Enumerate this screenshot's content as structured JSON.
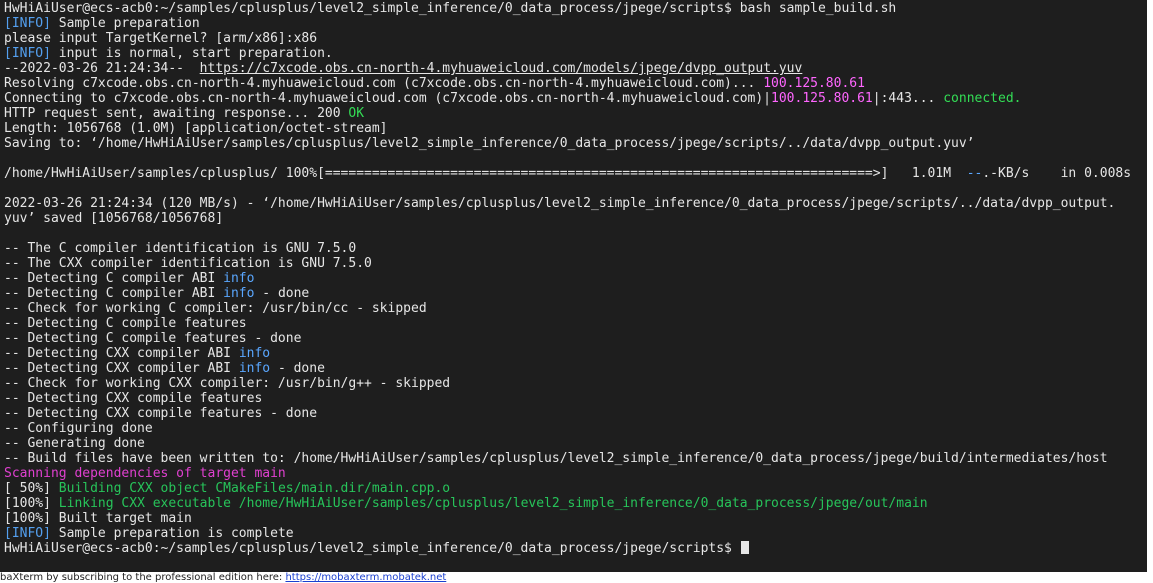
{
  "colors": {
    "background": "#1e1e1e",
    "text": "#e6e6e6",
    "info_tag": "#54a0f0",
    "ip_address": "#ff66ff",
    "ok": "#33dd55",
    "magenta": "#e040d0",
    "green": "#27c45a",
    "blue": "#5aa7ff"
  },
  "terminal": {
    "lines": [
      [
        {
          "t": "HwHiAiUser@ecs-acb0:~/samples/cplusplus/level2_simple_inference/0_data_process/jpege/scripts$ bash sample_build.sh",
          "c": "default"
        }
      ],
      [
        {
          "t": "[INFO]",
          "c": "info-tag"
        },
        {
          "t": " Sample preparation",
          "c": "default"
        }
      ],
      [
        {
          "t": "please input TargetKernel? [arm/x86]:x86",
          "c": "default"
        }
      ],
      [
        {
          "t": "[INFO]",
          "c": "info-tag"
        },
        {
          "t": " input is normal, start preparation.",
          "c": "default"
        }
      ],
      [
        {
          "t": "--2022-03-26 21:24:34--  ",
          "c": "default"
        },
        {
          "t": "https://c7xcode.obs.cn-north-4.myhuaweicloud.com/models/jpege/dvpp_output.yuv",
          "c": "url"
        }
      ],
      [
        {
          "t": "Resolving c7xcode.obs.cn-north-4.myhuaweicloud.com (c7xcode.obs.cn-north-4.myhuaweicloud.com)... ",
          "c": "default"
        },
        {
          "t": "100.125.80.61",
          "c": "ip"
        }
      ],
      [
        {
          "t": "Connecting to c7xcode.obs.cn-north-4.myhuaweicloud.com (c7xcode.obs.cn-north-4.myhuaweicloud.com)|",
          "c": "default"
        },
        {
          "t": "100.125.80.61",
          "c": "ip"
        },
        {
          "t": "|:443... ",
          "c": "default"
        },
        {
          "t": "connected.",
          "c": "ok"
        }
      ],
      [
        {
          "t": "HTTP request sent, awaiting response... 200 ",
          "c": "default"
        },
        {
          "t": "OK",
          "c": "ok"
        }
      ],
      [
        {
          "t": "Length: 1056768 (1.0M) [application/octet-stream]",
          "c": "default"
        }
      ],
      [
        {
          "t": "Saving to: ‘/home/HwHiAiUser/samples/cplusplus/level2_simple_inference/0_data_process/jpege/scripts/../data/dvpp_output.yuv’",
          "c": "default"
        }
      ],
      [
        {
          "t": "",
          "c": "default"
        }
      ],
      [
        {
          "t": "/home/HwHiAiUser/samples/cplusplus/ 100%[======================================================================>]   1.01M  ",
          "c": "default"
        },
        {
          "t": "--",
          "c": "blue"
        },
        {
          "t": ".-KB/s    in 0.008s",
          "c": "default"
        }
      ],
      [
        {
          "t": "",
          "c": "default"
        }
      ],
      [
        {
          "t": "2022-03-26 21:24:34 (120 MB/s) - ‘/home/HwHiAiUser/samples/cplusplus/level2_simple_inference/0_data_process/jpege/scripts/../data/dvpp_output.",
          "c": "default"
        }
      ],
      [
        {
          "t": "yuv’ saved [1056768/1056768]",
          "c": "default"
        }
      ],
      [
        {
          "t": "",
          "c": "default"
        }
      ],
      [
        {
          "t": "-- The C compiler identification is GNU 7.5.0",
          "c": "default"
        }
      ],
      [
        {
          "t": "-- The CXX compiler identification is GNU 7.5.0",
          "c": "default"
        }
      ],
      [
        {
          "t": "-- Detecting C compiler ABI ",
          "c": "default"
        },
        {
          "t": "info",
          "c": "blue"
        }
      ],
      [
        {
          "t": "-- Detecting C compiler ABI ",
          "c": "default"
        },
        {
          "t": "info",
          "c": "blue"
        },
        {
          "t": " - done",
          "c": "default"
        }
      ],
      [
        {
          "t": "-- Check for working C compiler: /usr/bin/cc - skipped",
          "c": "default"
        }
      ],
      [
        {
          "t": "-- Detecting C compile features",
          "c": "default"
        }
      ],
      [
        {
          "t": "-- Detecting C compile features - done",
          "c": "default"
        }
      ],
      [
        {
          "t": "-- Detecting CXX compiler ABI ",
          "c": "default"
        },
        {
          "t": "info",
          "c": "blue"
        }
      ],
      [
        {
          "t": "-- Detecting CXX compiler ABI ",
          "c": "default"
        },
        {
          "t": "info",
          "c": "blue"
        },
        {
          "t": " - done",
          "c": "default"
        }
      ],
      [
        {
          "t": "-- Check for working CXX compiler: /usr/bin/g++ - skipped",
          "c": "default"
        }
      ],
      [
        {
          "t": "-- Detecting CXX compile features",
          "c": "default"
        }
      ],
      [
        {
          "t": "-- Detecting CXX compile features - done",
          "c": "default"
        }
      ],
      [
        {
          "t": "-- Configuring done",
          "c": "default"
        }
      ],
      [
        {
          "t": "-- Generating done",
          "c": "default"
        }
      ],
      [
        {
          "t": "-- Build files have been written to: /home/HwHiAiUser/samples/cplusplus/level2_simple_inference/0_data_process/jpege/build/intermediates/host",
          "c": "default"
        }
      ],
      [
        {
          "t": "Scanning dependencies of target main",
          "c": "magenta"
        }
      ],
      [
        {
          "t": "[ 50%] ",
          "c": "default"
        },
        {
          "t": "Building CXX object CMakeFiles/main.dir/main.cpp.o",
          "c": "green"
        }
      ],
      [
        {
          "t": "[100%] ",
          "c": "default"
        },
        {
          "t": "Linking CXX executable /home/HwHiAiUser/samples/cplusplus/level2_simple_inference/0_data_process/jpege/out/main",
          "c": "green"
        }
      ],
      [
        {
          "t": "[100%] Built target main",
          "c": "default"
        }
      ],
      [
        {
          "t": "[INFO]",
          "c": "info-tag"
        },
        {
          "t": " Sample preparation is complete",
          "c": "default"
        }
      ],
      [
        {
          "t": "HwHiAiUser@ecs-acb0:~/samples/cplusplus/level2_simple_inference/0_data_process/jpege/scripts$ ",
          "c": "default"
        }
      ]
    ]
  },
  "footer": {
    "text": "baXterm by subscribing to the professional edition here:  ",
    "link": "https://mobaxterm.mobatek.net"
  }
}
